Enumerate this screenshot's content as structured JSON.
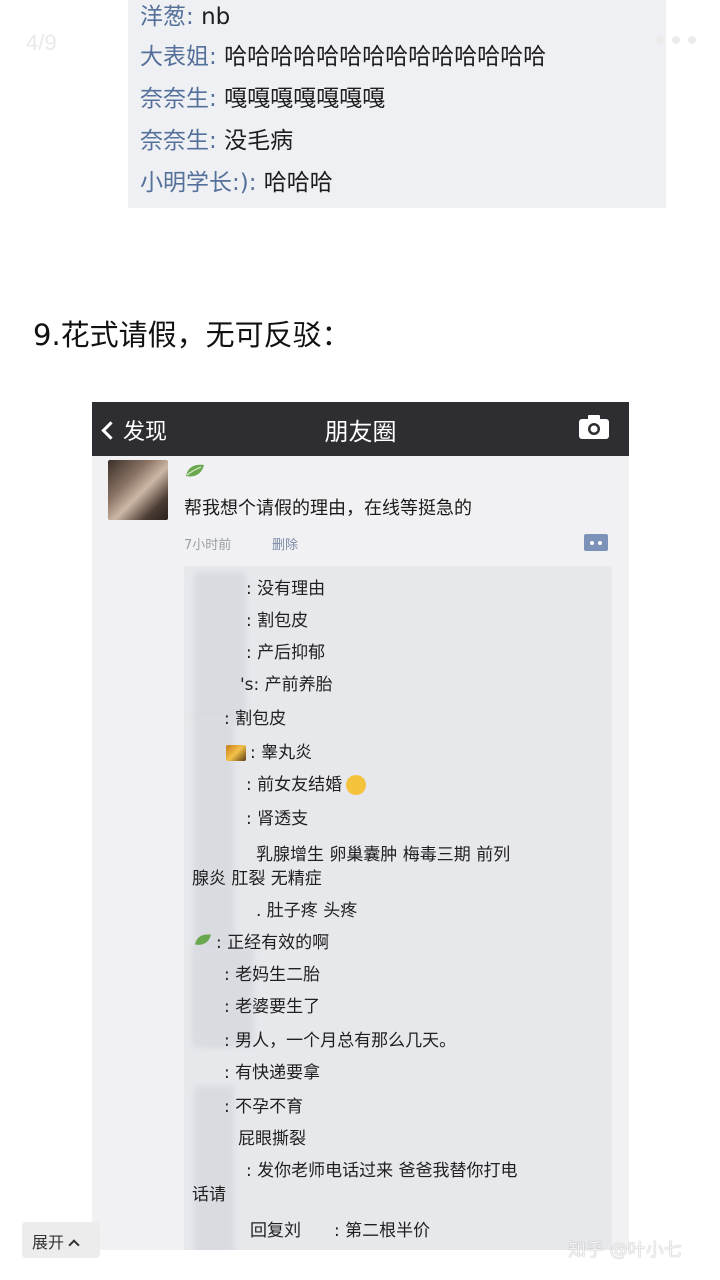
{
  "viewer": {
    "page_indicator": "4/9",
    "expand_label": "展开",
    "watermark": "知乎 @叶小七",
    "more_icon": "more-dots-icon"
  },
  "top_chat": {
    "lines": [
      {
        "name": "洋葱",
        "text": "nb"
      },
      {
        "name": "大表姐",
        "text": "哈哈哈哈哈哈哈哈哈哈哈哈哈哈"
      },
      {
        "name": "奈奈生",
        "text": "嘎嘎嘎嘎嘎嘎嘎"
      },
      {
        "name": "奈奈生",
        "text": "没毛病"
      },
      {
        "name": "小明学长:)",
        "text": "哈哈哈"
      }
    ]
  },
  "section_heading": "9.花式请假，无可反驳：",
  "moments": {
    "back_label": "发现",
    "title": "朋友圈",
    "camera_icon": "camera-icon",
    "post_text": "帮我想个请假的理由，在线等挺急的",
    "time": "7小时前",
    "delete_label": "删除",
    "comments": [
      ": 没有理由",
      ": 割包皮",
      ": 产后抑郁",
      "'s: 产前养胎",
      ": 割包皮",
      ": 睾丸炎",
      ": 前女友结婚",
      ": 肾透支",
      "乳腺增生  卵巢囊肿  梅毒三期  前列",
      "腺炎  肛裂  无精症",
      ". 肚子疼 头疼",
      ": 正经有效的啊",
      ": 老妈生二胎",
      ": 老婆要生了",
      ": 男人，一个月总有那么几天。",
      ": 有快递要拿",
      ": 不孕不育",
      "屁眼撕裂",
      ": 发你老师电话过来 爸爸我替你打电",
      "话请",
      "回复刘",
      ": 第二根半价"
    ]
  }
}
